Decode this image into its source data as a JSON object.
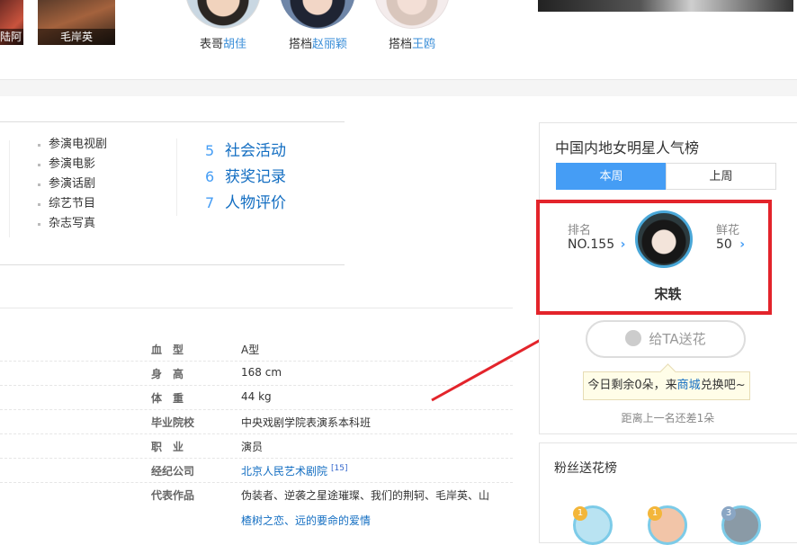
{
  "top_strip": {
    "left_thumb_caption": "陆阿",
    "thumb_caption": "毛岸英",
    "relations": [
      {
        "relation": "表哥",
        "name": "胡佳"
      },
      {
        "relation": "搭档",
        "name": "赵丽颖"
      },
      {
        "relation": "搭档",
        "name": "王鸥"
      }
    ]
  },
  "catalog": {
    "sub_items": [
      "参演电视剧",
      "参演电影",
      "参演话剧",
      "综艺节目",
      "杂志写真"
    ],
    "main_items": [
      {
        "num": "5",
        "label": "社会活动"
      },
      {
        "num": "6",
        "label": "获奖记录"
      },
      {
        "num": "7",
        "label": "人物评价"
      }
    ]
  },
  "info": {
    "rows": [
      {
        "key": "血　型",
        "value": "A型"
      },
      {
        "key": "身　高",
        "value": "168 cm"
      },
      {
        "key": "体　重",
        "value": "44 kg"
      },
      {
        "key": "毕业院校",
        "value": "中央戏剧学院表演系本科班"
      },
      {
        "key": "职　业",
        "value": "演员"
      },
      {
        "key": "经纪公司",
        "value": "北京人民艺术剧院",
        "ref": "[15]"
      },
      {
        "key": "代表作品",
        "value": "伪装者、逆袭之星途璀璨、我们的荆轲、毛岸英、山"
      }
    ],
    "works_continued": "楂树之恋、远的要命的爱情"
  },
  "ranking": {
    "title": "中国内地女明星人气榜",
    "tab_this_week": "本周",
    "tab_last_week": "上周",
    "rank_label": "排名",
    "rank_value": "NO.155",
    "flowers_label": "鲜花",
    "flowers_value": "50",
    "star_name": "宋轶",
    "send_button": "给TA送花",
    "tip_prefix": "今日剩余0朵，来",
    "tip_link": "商城",
    "tip_suffix": "兑换吧~",
    "gap_text": "距离上一名还差1朵"
  },
  "fans": {
    "title": "粉丝送花榜",
    "badges": [
      "1",
      "1",
      "3"
    ]
  },
  "colors": {
    "accent_blue": "#459df5",
    "link_blue": "#136ec2",
    "highlight_red": "#e3242b"
  }
}
